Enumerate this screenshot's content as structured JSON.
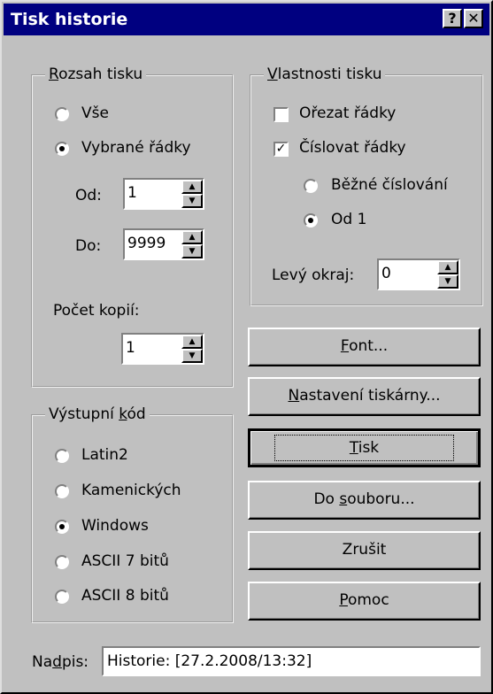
{
  "window": {
    "title": "Tisk historie",
    "help_glyph": "?",
    "close_glyph": "✕"
  },
  "range": {
    "label": "Rozsah tisku",
    "label_key": "R",
    "label_rest": "ozsah tisku",
    "all": "Vše",
    "selected": "Vybrané řádky",
    "from_label": "Od:",
    "from_value": "1",
    "to_label": "Do:",
    "to_value": "9999",
    "copies_label": "Počet kopií:",
    "copies_value": "1"
  },
  "props": {
    "label": "Vlastnosti tisku",
    "label_key": "V",
    "label_rest": "lastnosti tisku",
    "trim": "Ořezat řádky",
    "trim_checked": false,
    "number": "Číslovat řádky",
    "number_checked": true,
    "normal_numbering": "Běžné číslování",
    "from_one": "Od 1",
    "left_margin_label": "Levý okraj:",
    "left_margin_value": "0"
  },
  "encoding": {
    "label_pre": "Výstupní ",
    "label_key": "k",
    "label_post": "ód",
    "options": [
      "Latin2",
      "Kamenických",
      "Windows",
      "ASCII 7 bitů",
      "ASCII 8 bitů"
    ],
    "selected": "Windows"
  },
  "buttons": {
    "font_key": "F",
    "font_rest": "ont...",
    "printer_key": "N",
    "printer_rest": "astavení tiskárny...",
    "print_key": "T",
    "print_rest": "isk",
    "file_pre": "Do ",
    "file_key": "s",
    "file_rest": "ouboru...",
    "cancel": "Zrušit",
    "help_key": "P",
    "help_rest": "omoc"
  },
  "caption": {
    "label_pre": "Na",
    "label_key": "d",
    "label_post": "pis:",
    "value": "Historie:  [27.2.2008/13:32]"
  }
}
